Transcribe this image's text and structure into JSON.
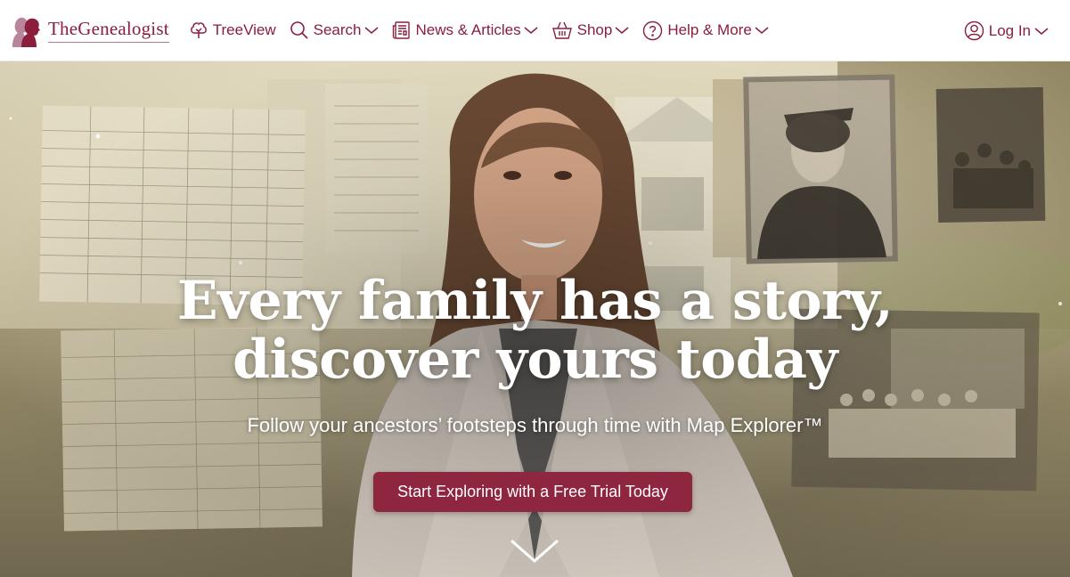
{
  "brand": {
    "name": "TheGenealogist",
    "accent_color": "#8a1e3c",
    "logo_icon": "silhouette-profiles-icon"
  },
  "nav": {
    "items": [
      {
        "label": "TreeView",
        "icon": "tree-icon",
        "dropdown": false
      },
      {
        "label": "Search",
        "icon": "search-icon",
        "dropdown": true
      },
      {
        "label": "News & Articles",
        "icon": "newspaper-icon",
        "dropdown": true
      },
      {
        "label": "Shop",
        "icon": "basket-icon",
        "dropdown": true
      },
      {
        "label": "Help & More",
        "icon": "help-icon",
        "dropdown": true
      }
    ],
    "login": {
      "label": "Log In",
      "icon": "user-icon",
      "dropdown": true
    }
  },
  "hero": {
    "headline_line1": "Every family has a story,",
    "headline_line2": "discover yours today",
    "subheadline": "Follow your ancestors’ footsteps through time with Map Explorer™",
    "cta_label": "Start Exploring with a Free Trial Today",
    "cta_color": "#8e2640",
    "scroll_icon": "chevron-down-icon"
  }
}
